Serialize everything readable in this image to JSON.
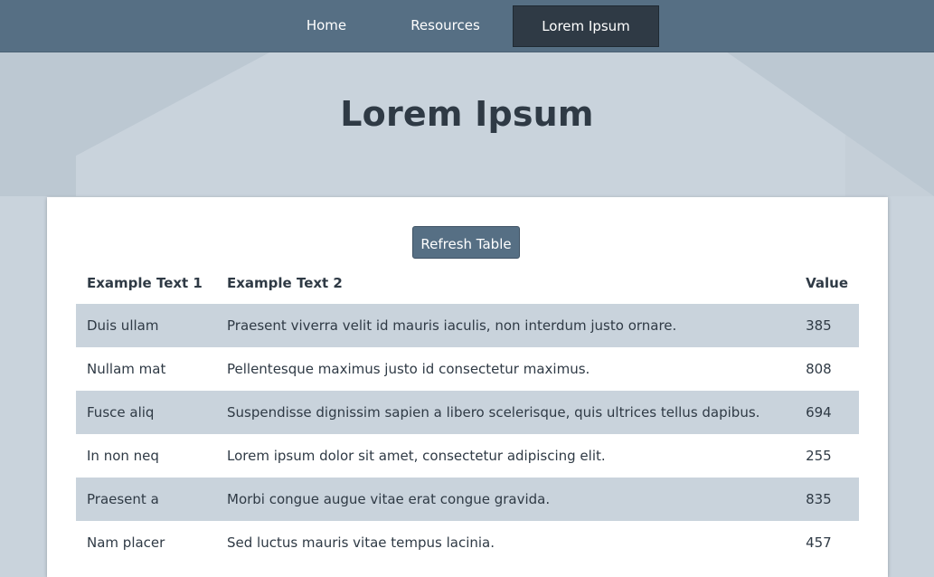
{
  "nav": {
    "items": [
      {
        "label": "Home"
      },
      {
        "label": "Resources"
      },
      {
        "label": "Lorem Ipsum",
        "active": true
      }
    ]
  },
  "page": {
    "title": "Lorem Ipsum"
  },
  "card": {
    "refresh_label": "Refresh Table",
    "table": {
      "headers": [
        "Example Text 1",
        "Example Text 2",
        "Value"
      ],
      "rows": [
        [
          "Duis ullam",
          "Praesent viverra velit id mauris iaculis, non interdum justo ornare.",
          "385"
        ],
        [
          "Nullam mat",
          "Pellentesque maximus justo id consectetur maximus.",
          "808"
        ],
        [
          "Fusce aliq",
          "Suspendisse dignissim sapien a libero scelerisque, quis ultrices tellus dapibus.",
          "694"
        ],
        [
          "In non neq",
          "Lorem ipsum dolor sit amet, consectetur adipiscing elit.",
          "255"
        ],
        [
          "Praesent a",
          "Morbi congue augue vitae erat congue gravida.",
          "835"
        ],
        [
          "Nam placer",
          "Sed luctus mauris vitae tempus lacinia.",
          "457"
        ]
      ]
    }
  },
  "colors": {
    "navbar": "#566f84",
    "nav_active": "#2f3a45",
    "background": "#c9d3dc",
    "row_shade": "#c9d3dc",
    "text": "#2f3a45"
  }
}
